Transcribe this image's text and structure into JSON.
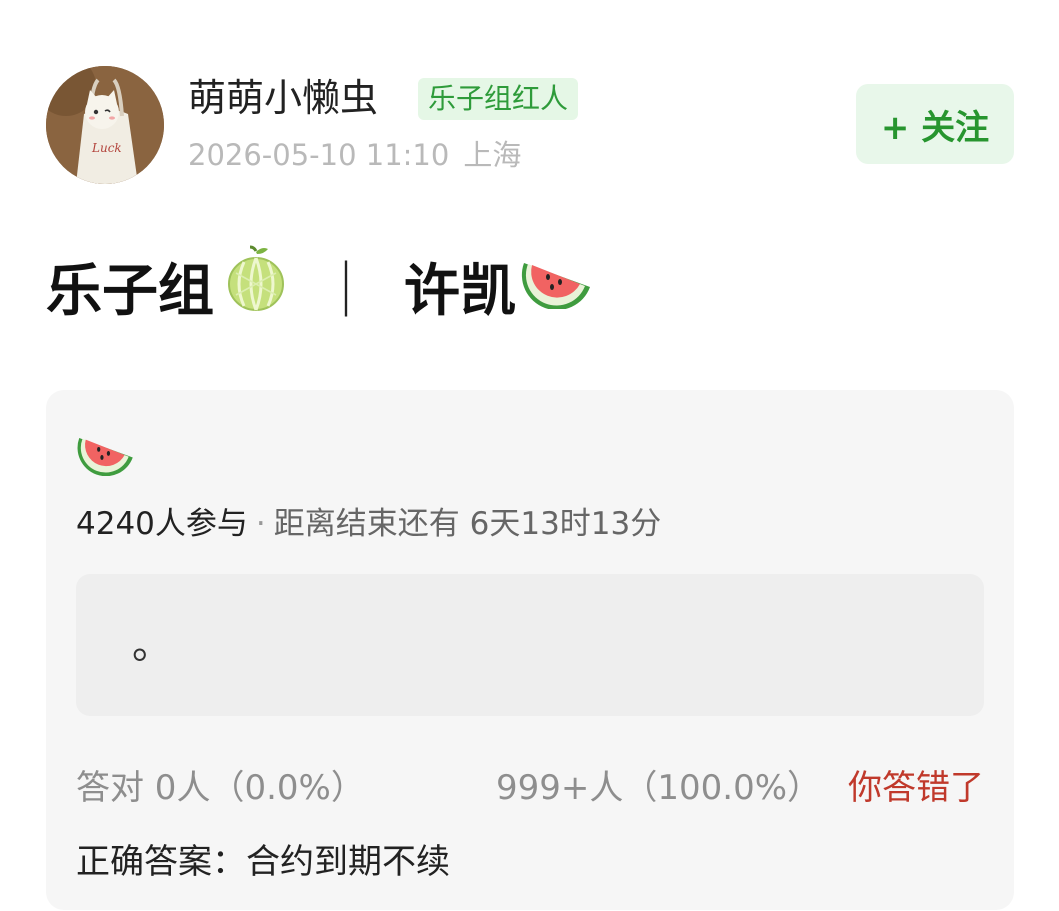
{
  "author": {
    "name": "萌萌小懒虫",
    "badge": "乐子组红人",
    "date": "2026-05-10 11:10",
    "location": "上海",
    "avatar_text": "Luck"
  },
  "follow_button": "+ 关注",
  "post": {
    "title_part1": "乐子组",
    "title_sep": "｜",
    "title_part2": "许凯"
  },
  "quiz": {
    "participants": "4240人参与",
    "separator": "·",
    "time_left": "距离结束还有 6天13时13分",
    "option_text": "。",
    "correct_stat": "答对  0人（0.0%）",
    "wrong_stat": "999+人（100.0%）",
    "result_message": "你答错了",
    "answer_label": "正确答案：",
    "answer_value": "合约到期不续"
  },
  "icons": {
    "melon": "melon-icon",
    "watermelon": "watermelon-icon"
  },
  "colors": {
    "accent_green": "#27952f",
    "badge_bg": "#e5f7e6",
    "error_red": "#c0392b",
    "card_bg": "#f6f6f6"
  }
}
